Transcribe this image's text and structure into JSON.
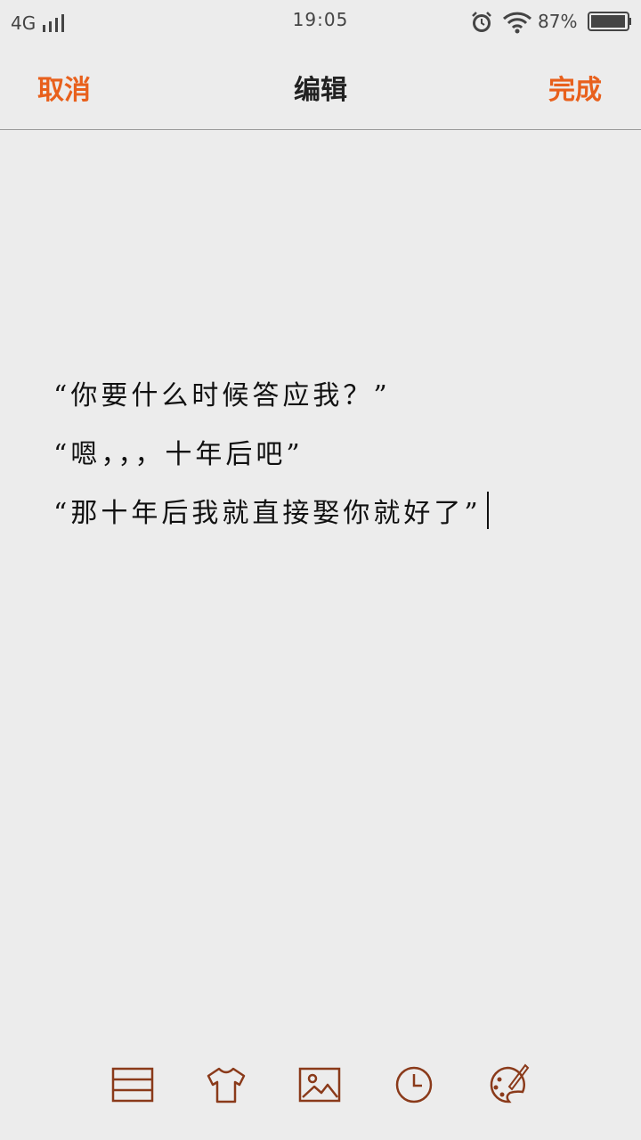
{
  "status_bar": {
    "network": "4G",
    "time": "19:05",
    "battery_percent": "87%",
    "icons": [
      "signal-icon",
      "alarm-icon",
      "wifi-icon",
      "battery-icon"
    ]
  },
  "nav": {
    "cancel_label": "取消",
    "title": "编辑",
    "done_label": "完成"
  },
  "note": {
    "lines": [
      "“你要什么时候答应我？”",
      "“嗯，，，十年后吧”",
      "“那十年后我就直接娶你就好了”"
    ]
  },
  "toolbar": {
    "icons": [
      "list-icon",
      "tshirt-icon",
      "image-icon",
      "clock-icon",
      "palette-icon"
    ]
  },
  "colors": {
    "accent": "#e8601c",
    "icon_stroke": "#8a3a1a",
    "background": "#ececec",
    "text": "#111111"
  }
}
